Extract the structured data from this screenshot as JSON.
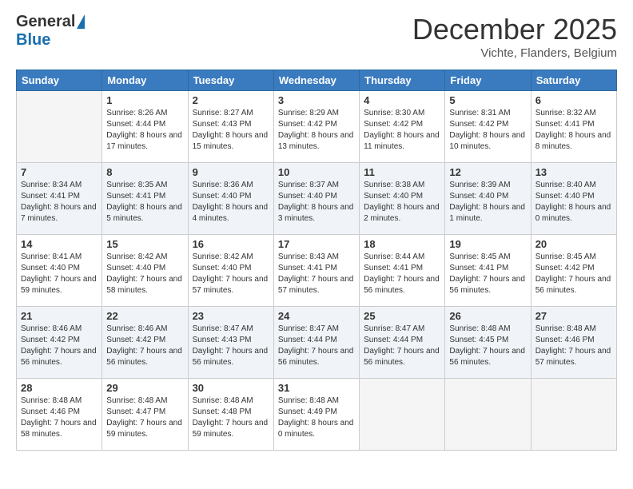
{
  "logo": {
    "general": "General",
    "blue": "Blue"
  },
  "header": {
    "month": "December 2025",
    "location": "Vichte, Flanders, Belgium"
  },
  "weekdays": [
    "Sunday",
    "Monday",
    "Tuesday",
    "Wednesday",
    "Thursday",
    "Friday",
    "Saturday"
  ],
  "weeks": [
    [
      {
        "day": "",
        "sunrise": "",
        "sunset": "",
        "daylight": ""
      },
      {
        "day": "1",
        "sunrise": "Sunrise: 8:26 AM",
        "sunset": "Sunset: 4:44 PM",
        "daylight": "Daylight: 8 hours and 17 minutes."
      },
      {
        "day": "2",
        "sunrise": "Sunrise: 8:27 AM",
        "sunset": "Sunset: 4:43 PM",
        "daylight": "Daylight: 8 hours and 15 minutes."
      },
      {
        "day": "3",
        "sunrise": "Sunrise: 8:29 AM",
        "sunset": "Sunset: 4:42 PM",
        "daylight": "Daylight: 8 hours and 13 minutes."
      },
      {
        "day": "4",
        "sunrise": "Sunrise: 8:30 AM",
        "sunset": "Sunset: 4:42 PM",
        "daylight": "Daylight: 8 hours and 11 minutes."
      },
      {
        "day": "5",
        "sunrise": "Sunrise: 8:31 AM",
        "sunset": "Sunset: 4:42 PM",
        "daylight": "Daylight: 8 hours and 10 minutes."
      },
      {
        "day": "6",
        "sunrise": "Sunrise: 8:32 AM",
        "sunset": "Sunset: 4:41 PM",
        "daylight": "Daylight: 8 hours and 8 minutes."
      }
    ],
    [
      {
        "day": "7",
        "sunrise": "Sunrise: 8:34 AM",
        "sunset": "Sunset: 4:41 PM",
        "daylight": "Daylight: 8 hours and 7 minutes."
      },
      {
        "day": "8",
        "sunrise": "Sunrise: 8:35 AM",
        "sunset": "Sunset: 4:41 PM",
        "daylight": "Daylight: 8 hours and 5 minutes."
      },
      {
        "day": "9",
        "sunrise": "Sunrise: 8:36 AM",
        "sunset": "Sunset: 4:40 PM",
        "daylight": "Daylight: 8 hours and 4 minutes."
      },
      {
        "day": "10",
        "sunrise": "Sunrise: 8:37 AM",
        "sunset": "Sunset: 4:40 PM",
        "daylight": "Daylight: 8 hours and 3 minutes."
      },
      {
        "day": "11",
        "sunrise": "Sunrise: 8:38 AM",
        "sunset": "Sunset: 4:40 PM",
        "daylight": "Daylight: 8 hours and 2 minutes."
      },
      {
        "day": "12",
        "sunrise": "Sunrise: 8:39 AM",
        "sunset": "Sunset: 4:40 PM",
        "daylight": "Daylight: 8 hours and 1 minute."
      },
      {
        "day": "13",
        "sunrise": "Sunrise: 8:40 AM",
        "sunset": "Sunset: 4:40 PM",
        "daylight": "Daylight: 8 hours and 0 minutes."
      }
    ],
    [
      {
        "day": "14",
        "sunrise": "Sunrise: 8:41 AM",
        "sunset": "Sunset: 4:40 PM",
        "daylight": "Daylight: 7 hours and 59 minutes."
      },
      {
        "day": "15",
        "sunrise": "Sunrise: 8:42 AM",
        "sunset": "Sunset: 4:40 PM",
        "daylight": "Daylight: 7 hours and 58 minutes."
      },
      {
        "day": "16",
        "sunrise": "Sunrise: 8:42 AM",
        "sunset": "Sunset: 4:40 PM",
        "daylight": "Daylight: 7 hours and 57 minutes."
      },
      {
        "day": "17",
        "sunrise": "Sunrise: 8:43 AM",
        "sunset": "Sunset: 4:41 PM",
        "daylight": "Daylight: 7 hours and 57 minutes."
      },
      {
        "day": "18",
        "sunrise": "Sunrise: 8:44 AM",
        "sunset": "Sunset: 4:41 PM",
        "daylight": "Daylight: 7 hours and 56 minutes."
      },
      {
        "day": "19",
        "sunrise": "Sunrise: 8:45 AM",
        "sunset": "Sunset: 4:41 PM",
        "daylight": "Daylight: 7 hours and 56 minutes."
      },
      {
        "day": "20",
        "sunrise": "Sunrise: 8:45 AM",
        "sunset": "Sunset: 4:42 PM",
        "daylight": "Daylight: 7 hours and 56 minutes."
      }
    ],
    [
      {
        "day": "21",
        "sunrise": "Sunrise: 8:46 AM",
        "sunset": "Sunset: 4:42 PM",
        "daylight": "Daylight: 7 hours and 56 minutes."
      },
      {
        "day": "22",
        "sunrise": "Sunrise: 8:46 AM",
        "sunset": "Sunset: 4:42 PM",
        "daylight": "Daylight: 7 hours and 56 minutes."
      },
      {
        "day": "23",
        "sunrise": "Sunrise: 8:47 AM",
        "sunset": "Sunset: 4:43 PM",
        "daylight": "Daylight: 7 hours and 56 minutes."
      },
      {
        "day": "24",
        "sunrise": "Sunrise: 8:47 AM",
        "sunset": "Sunset: 4:44 PM",
        "daylight": "Daylight: 7 hours and 56 minutes."
      },
      {
        "day": "25",
        "sunrise": "Sunrise: 8:47 AM",
        "sunset": "Sunset: 4:44 PM",
        "daylight": "Daylight: 7 hours and 56 minutes."
      },
      {
        "day": "26",
        "sunrise": "Sunrise: 8:48 AM",
        "sunset": "Sunset: 4:45 PM",
        "daylight": "Daylight: 7 hours and 56 minutes."
      },
      {
        "day": "27",
        "sunrise": "Sunrise: 8:48 AM",
        "sunset": "Sunset: 4:46 PM",
        "daylight": "Daylight: 7 hours and 57 minutes."
      }
    ],
    [
      {
        "day": "28",
        "sunrise": "Sunrise: 8:48 AM",
        "sunset": "Sunset: 4:46 PM",
        "daylight": "Daylight: 7 hours and 58 minutes."
      },
      {
        "day": "29",
        "sunrise": "Sunrise: 8:48 AM",
        "sunset": "Sunset: 4:47 PM",
        "daylight": "Daylight: 7 hours and 59 minutes."
      },
      {
        "day": "30",
        "sunrise": "Sunrise: 8:48 AM",
        "sunset": "Sunset: 4:48 PM",
        "daylight": "Daylight: 7 hours and 59 minutes."
      },
      {
        "day": "31",
        "sunrise": "Sunrise: 8:48 AM",
        "sunset": "Sunset: 4:49 PM",
        "daylight": "Daylight: 8 hours and 0 minutes."
      },
      {
        "day": "",
        "sunrise": "",
        "sunset": "",
        "daylight": ""
      },
      {
        "day": "",
        "sunrise": "",
        "sunset": "",
        "daylight": ""
      },
      {
        "day": "",
        "sunrise": "",
        "sunset": "",
        "daylight": ""
      }
    ]
  ]
}
